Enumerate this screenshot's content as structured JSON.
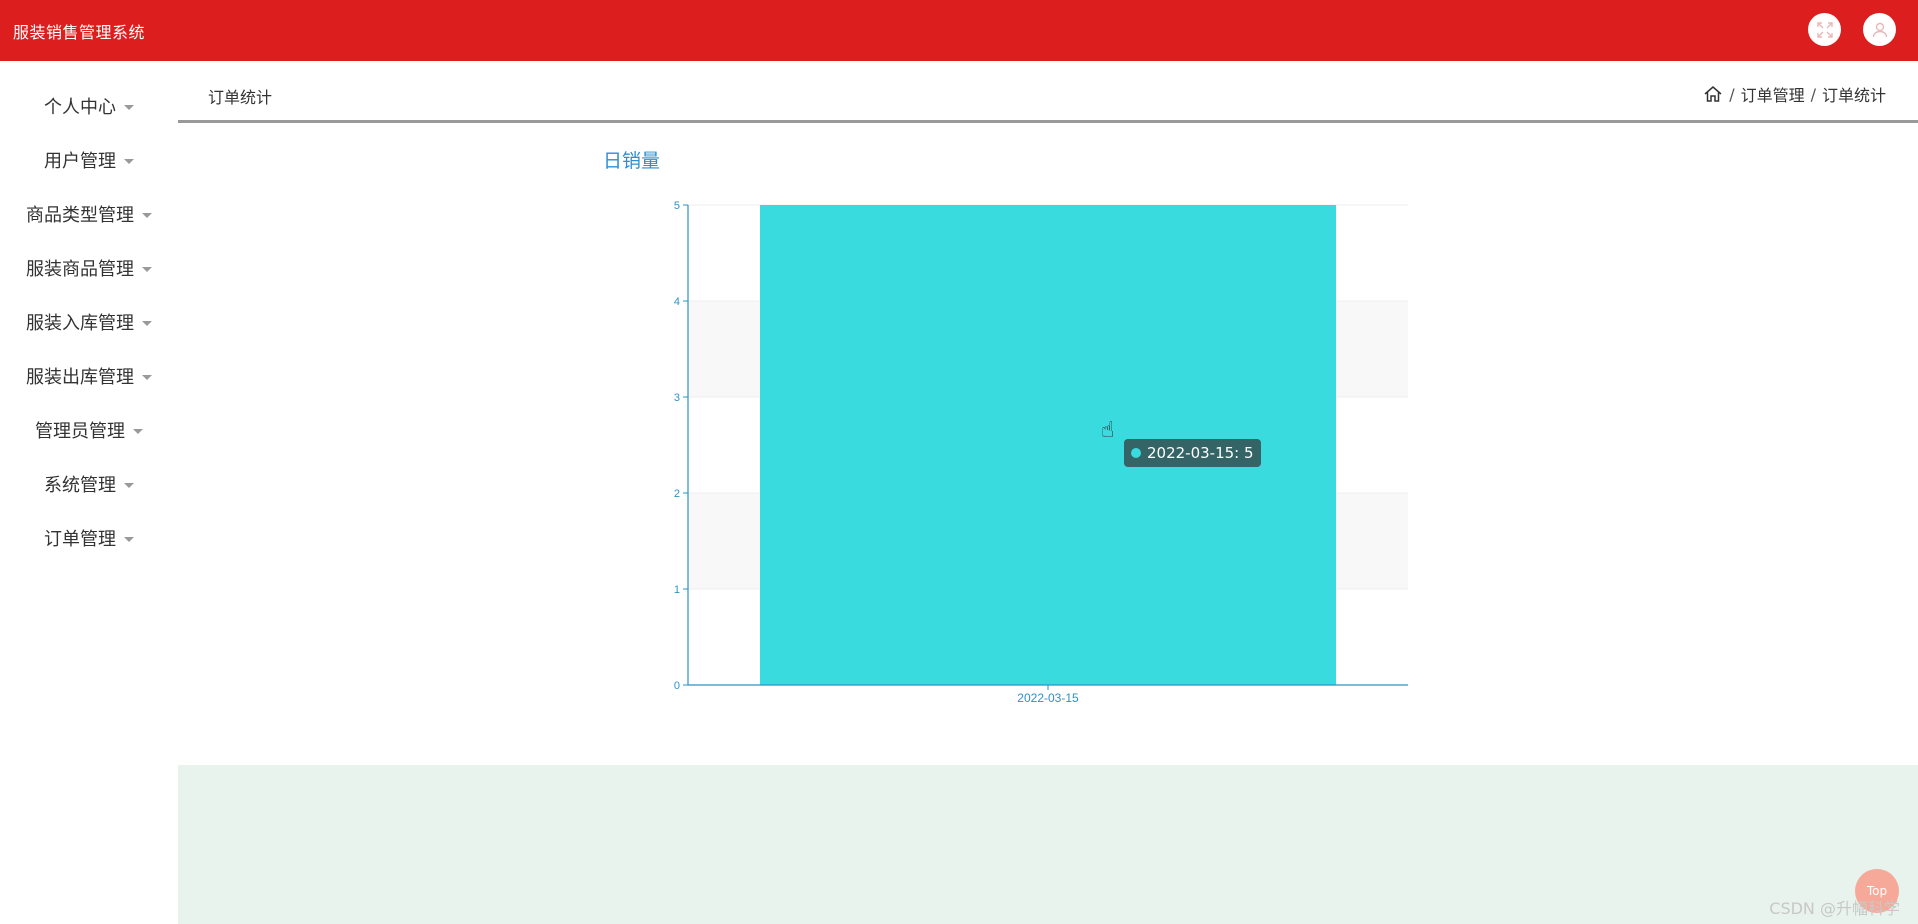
{
  "app": {
    "title": "服装销售管理系统"
  },
  "topbar": {
    "fullscreen_icon": "fullscreen-icon",
    "user_icon": "user-icon"
  },
  "sidebar": {
    "items": [
      {
        "label": "个人中心"
      },
      {
        "label": "用户管理"
      },
      {
        "label": "商品类型管理"
      },
      {
        "label": "服装商品管理"
      },
      {
        "label": "服装入库管理"
      },
      {
        "label": "服装出库管理"
      },
      {
        "label": "管理员管理"
      },
      {
        "label": "系统管理"
      },
      {
        "label": "订单管理"
      }
    ]
  },
  "header": {
    "page_title": "订单统计",
    "breadcrumb": [
      "订单管理",
      "订单统计"
    ],
    "separator": "/"
  },
  "chart_data": {
    "type": "bar",
    "title": "日销量",
    "categories": [
      "2022-03-15"
    ],
    "values": [
      5
    ],
    "ylim": [
      0,
      5
    ],
    "yticks": [
      0,
      1,
      2,
      3,
      4,
      5
    ],
    "bar_color": "#3adbde",
    "axis_color": "#2a93c9",
    "grid": true
  },
  "tooltip": {
    "text": "2022-03-15: 5"
  },
  "footer": {
    "watermark": "CSDN @升幅科学",
    "top_button": "Top"
  },
  "colors": {
    "topbar": "#dc1e1e",
    "accent": "#2d8fd0",
    "footer_band": "#e8f3ed"
  }
}
